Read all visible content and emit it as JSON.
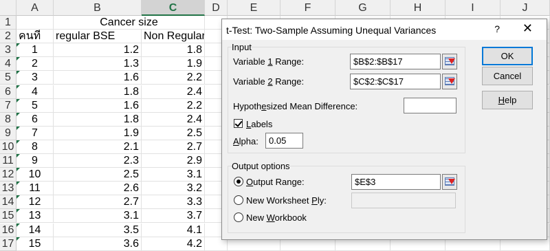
{
  "sheet": {
    "column_headers": [
      "A",
      "B",
      "C",
      "D",
      "E",
      "F",
      "G",
      "H",
      "I",
      "J"
    ],
    "selected_column": "C",
    "row_numbers": [
      "1",
      "2",
      "3",
      "4",
      "5",
      "6",
      "7",
      "8",
      "9",
      "10",
      "11",
      "12",
      "13",
      "14",
      "15",
      "16",
      "17"
    ],
    "title_cell": "Cancer size",
    "header_row": [
      "คนที่",
      "regular BSE",
      "Non Regular"
    ],
    "rows": [
      [
        "1",
        "1.2",
        "1.8"
      ],
      [
        "2",
        "1.3",
        "1.9"
      ],
      [
        "3",
        "1.6",
        "2.2"
      ],
      [
        "4",
        "1.8",
        "2.4"
      ],
      [
        "5",
        "1.6",
        "2.2"
      ],
      [
        "6",
        "1.8",
        "2.4"
      ],
      [
        "7",
        "1.9",
        "2.5"
      ],
      [
        "8",
        "2.1",
        "2.7"
      ],
      [
        "9",
        "2.3",
        "2.9"
      ],
      [
        "10",
        "2.5",
        "3.1"
      ],
      [
        "11",
        "2.6",
        "3.2"
      ],
      [
        "12",
        "2.7",
        "3.3"
      ],
      [
        "13",
        "3.1",
        "3.7"
      ],
      [
        "14",
        "3.5",
        "4.1"
      ],
      [
        "15",
        "3.6",
        "4.2"
      ]
    ]
  },
  "dialog": {
    "title": "t-Test: Two-Sample Assuming Unequal Variances",
    "help_symbol": "?",
    "close_symbol": "✕",
    "input_group": "Input",
    "var1": {
      "pre": "Variable ",
      "key": "1",
      "post": " Range:",
      "value": "$B$2:$B$17"
    },
    "var2": {
      "pre": "Variable ",
      "key": "2",
      "post": " Range:",
      "value": "$C$2:$C$17"
    },
    "hyp": {
      "pre": "Hypoth",
      "key": "e",
      "post": "sized Mean Difference:",
      "value": ""
    },
    "labels": {
      "key": "L",
      "post": "abels",
      "checked": true
    },
    "alpha": {
      "key": "A",
      "post": "lpha:",
      "value": "0.05"
    },
    "output_group": "Output options",
    "output_range": {
      "key": "O",
      "post": "utput Range:",
      "value": "$E$3",
      "selected": true
    },
    "new_ply": {
      "pre": "New Worksheet ",
      "key": "P",
      "post": "ly:",
      "value": ""
    },
    "new_workbook": {
      "pre": "New ",
      "key": "W",
      "post": "orkbook"
    },
    "ok": "OK",
    "cancel": "Cancel",
    "help": {
      "key": "H",
      "post": "elp"
    }
  }
}
